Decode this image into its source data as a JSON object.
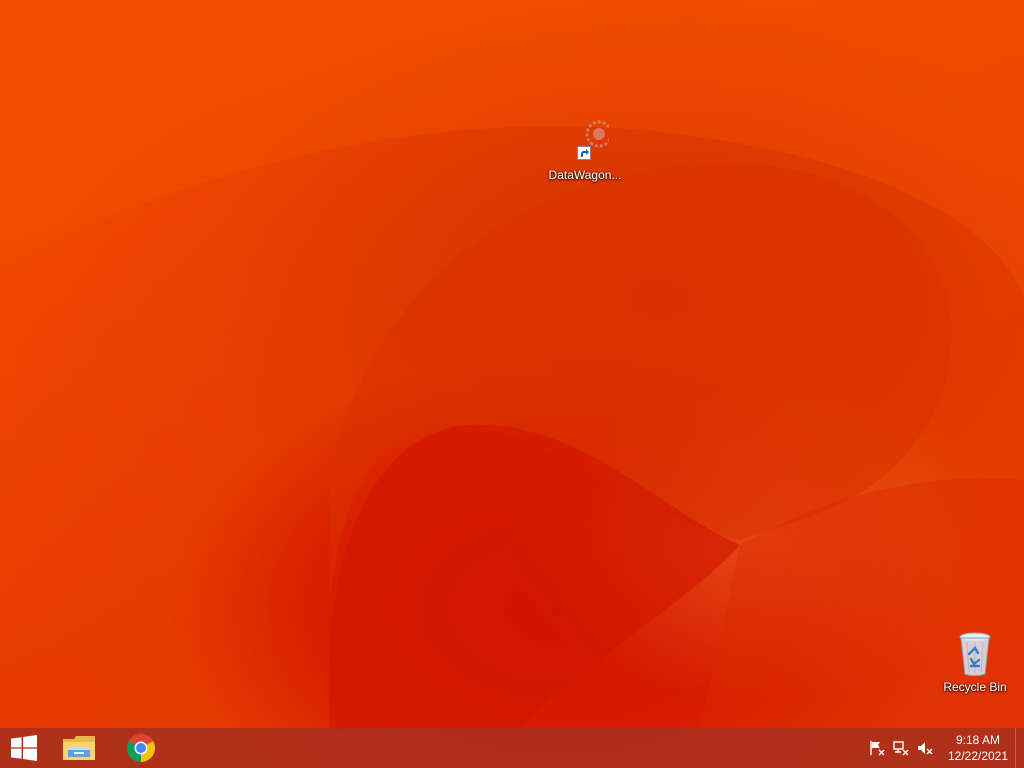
{
  "desktop": {
    "icons": [
      {
        "label": "DataWagon...",
        "icon": "datawagon-shortcut-icon"
      },
      {
        "label": "Recycle Bin",
        "icon": "recycle-bin-icon"
      }
    ]
  },
  "taskbar": {
    "start_icon": "windows-logo-icon",
    "pinned": [
      {
        "name": "File Explorer",
        "icon": "file-explorer-icon"
      },
      {
        "name": "Google Chrome",
        "icon": "chrome-icon"
      }
    ],
    "tray": {
      "icons": [
        "action-center-flag-icon",
        "network-icon",
        "volume-muted-icon"
      ],
      "time": "9:18 AM",
      "date": "12/22/2021"
    }
  },
  "colors": {
    "wallpaper_primary": "#ee4500",
    "wallpaper_dark": "#d21400",
    "taskbar": "#a8301e"
  }
}
